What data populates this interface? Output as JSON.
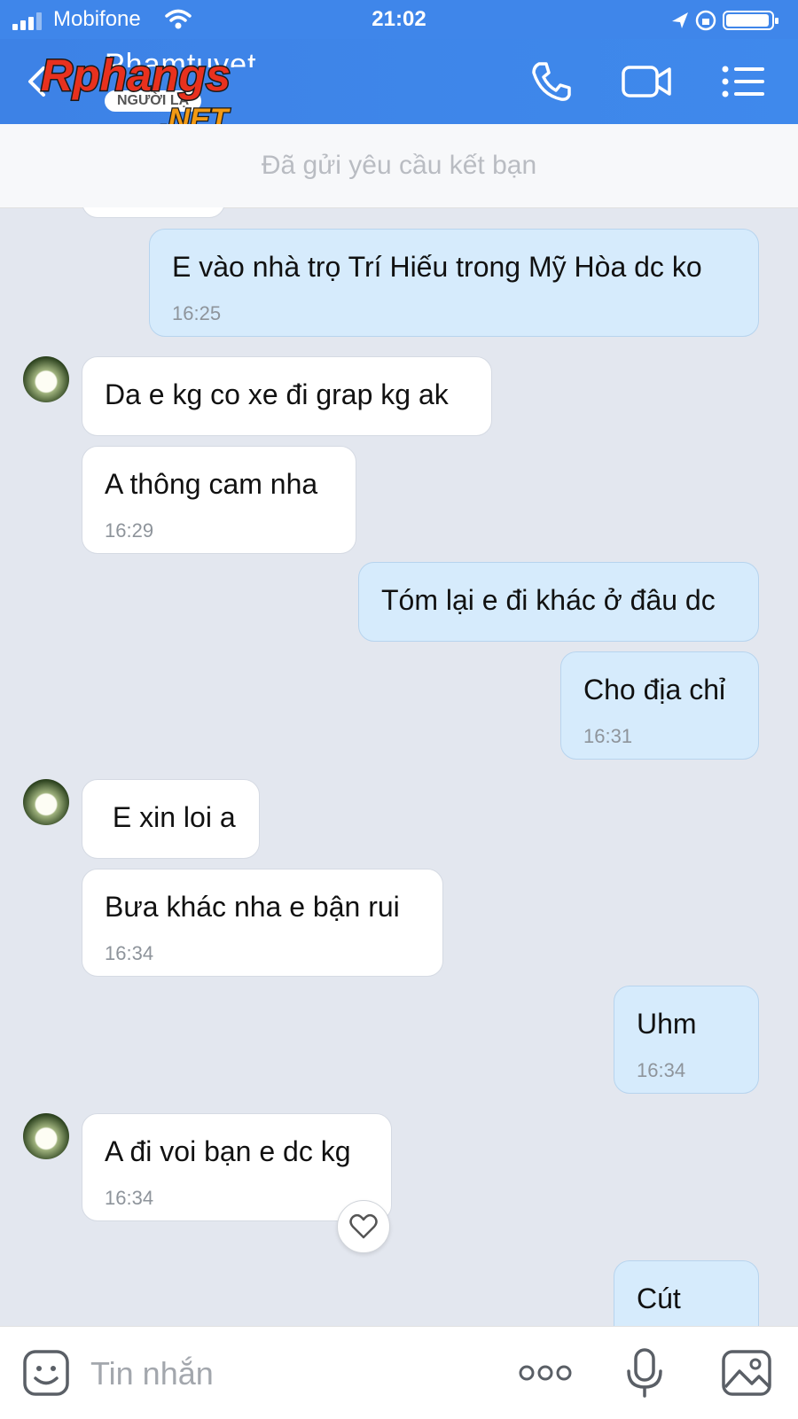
{
  "status_bar": {
    "carrier": "Mobifone",
    "time": "21:02"
  },
  "header": {
    "contact_name": "Phamtuyet",
    "subtitle": "NGƯỜI LẠ",
    "watermark": "Rphangs .NET"
  },
  "request_banner": "Đã gửi yêu cầu kết bạn",
  "messages": [
    {
      "side": "out",
      "text": "E vào nhà trọ Trí Hiếu trong Mỹ Hòa dc ko",
      "time": "16:25"
    },
    {
      "side": "in",
      "text": "Da e kg co xe đi grap kg ak",
      "time": ""
    },
    {
      "side": "in",
      "text": "A thông cam nha",
      "time": "16:29"
    },
    {
      "side": "out",
      "text": "Tóm lại e đi khác ở đâu dc",
      "time": ""
    },
    {
      "side": "out",
      "text": "Cho địa chỉ",
      "time": "16:31"
    },
    {
      "side": "in",
      "text": " E xin loi a",
      "time": ""
    },
    {
      "side": "in",
      "text": "Bưa khác nha e bận rui",
      "time": "16:34"
    },
    {
      "side": "out",
      "text": "Uhm",
      "time": "16:34"
    },
    {
      "side": "in",
      "text": "A đi voi bạn e dc kg",
      "time": "16:34"
    },
    {
      "side": "out",
      "text": "Cút",
      "time": ""
    }
  ],
  "input": {
    "placeholder": "Tin nhắn"
  },
  "icons": {
    "back": "chevron-left-icon",
    "call": "phone-icon",
    "video": "video-camera-icon",
    "menu": "list-menu-icon",
    "sticker": "emoji-face-icon",
    "more": "more-dots-icon",
    "voice": "microphone-icon",
    "image": "image-gallery-icon",
    "reaction": "heart-icon"
  },
  "colors": {
    "header": "#3f86ea",
    "chat_background": "#e3e7ef",
    "outgoing_bubble": "#d6ebfc",
    "incoming_bubble": "#ffffff"
  }
}
